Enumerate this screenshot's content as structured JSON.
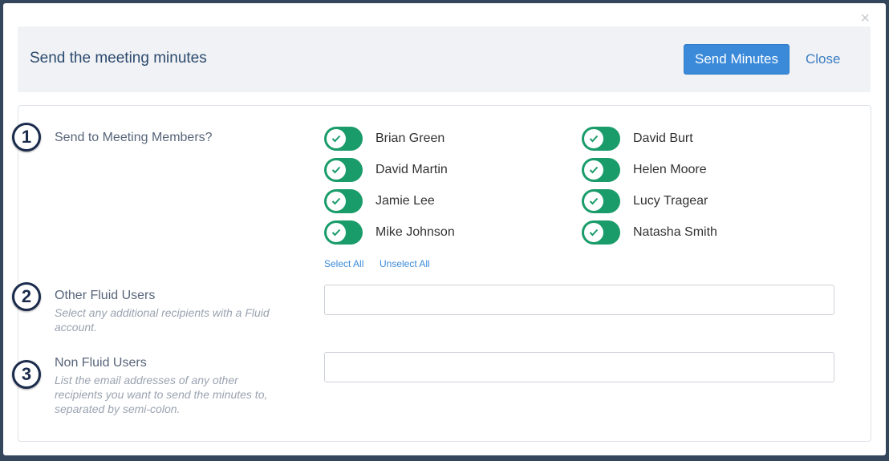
{
  "modal": {
    "title": "Send the meeting minutes",
    "send_label": "Send Minutes",
    "close_label": "Close",
    "close_icon": "×"
  },
  "sections": {
    "members": {
      "step": "1",
      "label": "Send to Meeting Members?"
    },
    "fluid_users": {
      "step": "2",
      "label": "Other Fluid Users",
      "help": "Select any additional recipients with a Fluid account.",
      "value": "",
      "placeholder": ""
    },
    "non_fluid_users": {
      "step": "3",
      "label": "Non Fluid Users",
      "help": "List the email addresses of any other recipients you want to send the minutes to, separated by semi-colon.",
      "value": "",
      "placeholder": ""
    }
  },
  "members": [
    {
      "name": "Brian Green",
      "checked": true
    },
    {
      "name": "David Burt",
      "checked": true
    },
    {
      "name": "David Martin",
      "checked": true
    },
    {
      "name": "Helen Moore",
      "checked": true
    },
    {
      "name": "Jamie Lee",
      "checked": true
    },
    {
      "name": "Lucy Tragear",
      "checked": true
    },
    {
      "name": "Mike Johnson",
      "checked": true
    },
    {
      "name": "Natasha Smith",
      "checked": true
    }
  ],
  "actions": {
    "select_all": "Select All",
    "unselect_all": "Unselect All"
  },
  "colors": {
    "toggle_on": "#199c6a",
    "primary": "#3b8ad9",
    "step_ring": "#1a2b4c"
  }
}
